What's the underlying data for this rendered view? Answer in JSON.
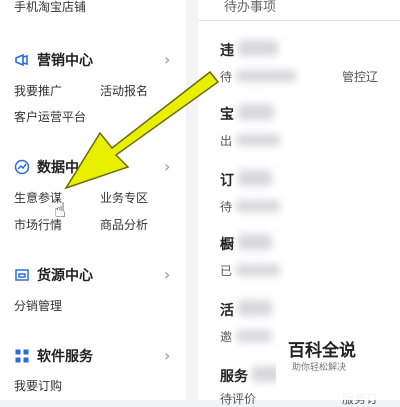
{
  "sidebar": {
    "top_item": "手机淘宝店铺",
    "sections": [
      {
        "title": "营销中心",
        "icon": "megaphone-icon",
        "links": [
          "我要推广",
          "活动报名",
          "客户运营平台"
        ]
      },
      {
        "title": "数据中心",
        "icon": "chart-icon",
        "links": [
          "生意参谋",
          "业务专区",
          "市场行情",
          "商品分析"
        ]
      },
      {
        "title": "货源中心",
        "icon": "storefront-icon",
        "links": [
          "分销管理"
        ]
      },
      {
        "title": "软件服务",
        "icon": "grid-icon",
        "links": [
          "我要订购"
        ]
      }
    ]
  },
  "content": {
    "pending_title": "待办事项",
    "rows": [
      {
        "title": "违",
        "sub": "待",
        "right_link": "管控辽"
      },
      {
        "title": "宝",
        "sub": "出"
      },
      {
        "title": "订",
        "sub": "待"
      },
      {
        "title": "橱",
        "sub": "已"
      },
      {
        "title": "活",
        "sub": "邀"
      },
      {
        "title": "服务",
        "sub": "待评价",
        "right_link": "服务订"
      }
    ]
  },
  "watermark": {
    "title": "百科全说",
    "subtitle": "助你轻松解决"
  },
  "colors": {
    "arrow": "#e8f000",
    "arrow_outline": "#6b6b00",
    "icon_blue": "#2d6cdf"
  }
}
